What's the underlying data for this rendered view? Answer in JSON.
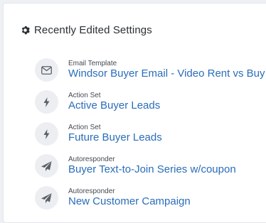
{
  "panel": {
    "title": "Recently Edited Settings",
    "title_icon": "gear-icon"
  },
  "items": [
    {
      "type": "Email Template",
      "name": "Windsor Buyer Email - Video Rent vs Buy",
      "icon": "envelope-icon"
    },
    {
      "type": "Action Set",
      "name": "Active Buyer Leads",
      "icon": "lightning-icon"
    },
    {
      "type": "Action Set",
      "name": "Future Buyer Leads",
      "icon": "lightning-icon"
    },
    {
      "type": "Autoresponder",
      "name": "Buyer Text-to-Join Series w/coupon",
      "icon": "paper-plane-icon"
    },
    {
      "type": "Autoresponder",
      "name": "New Customer Campaign",
      "icon": "paper-plane-icon"
    }
  ],
  "colors": {
    "link": "#2a6db8",
    "icon_bg": "#eceef1",
    "text": "#2b2f33"
  }
}
